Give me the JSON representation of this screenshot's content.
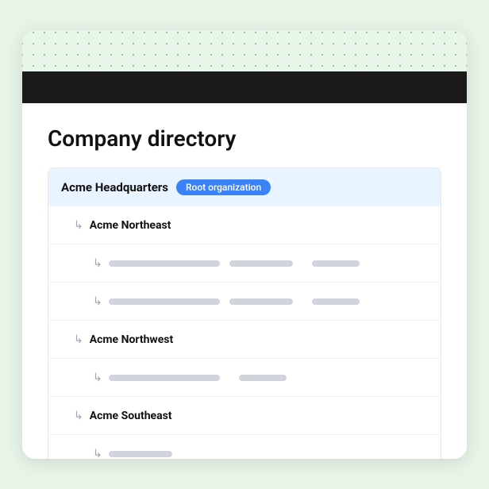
{
  "page": {
    "title": "Company directory"
  },
  "directory": {
    "root": {
      "name": "Acme Headquarters",
      "badge": "Root organization"
    },
    "rows": [
      {
        "type": "org",
        "level": 1,
        "label": "Acme Northeast"
      },
      {
        "type": "skeleton",
        "level": 2
      },
      {
        "type": "skeleton",
        "level": 2
      },
      {
        "type": "org",
        "level": 1,
        "label": "Acme Northwest"
      },
      {
        "type": "skeleton",
        "level": 2
      },
      {
        "type": "org",
        "level": 1,
        "label": "Acme Southeast"
      },
      {
        "type": "skeleton",
        "level": 2
      }
    ],
    "arrow_char": "↳"
  }
}
